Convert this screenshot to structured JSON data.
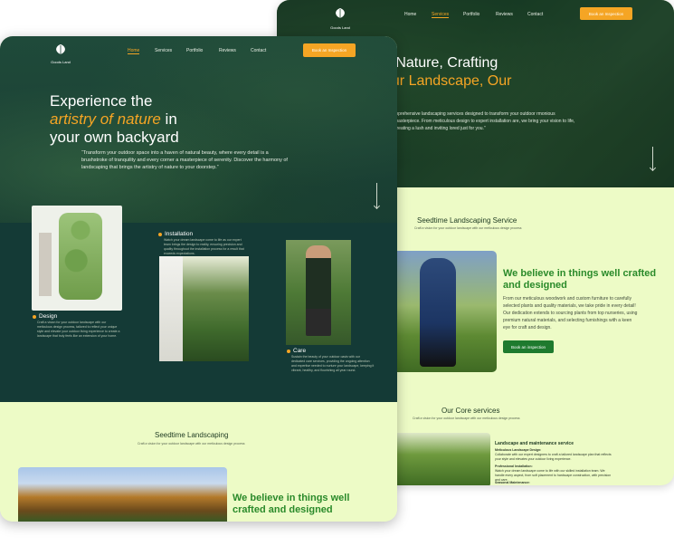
{
  "back": {
    "logo_text": "Goods Land",
    "nav": [
      "Home",
      "Services",
      "Portfolio",
      "Reviews",
      "Contact"
    ],
    "cta": "Book an Inspection",
    "hero_line1": "g Nature, Crafting",
    "hero_line2_white": "",
    "hero_line2_gold": "our Landscape, Our",
    "hero_line3": ".”",
    "hero_text": "mprehensive landscaping services designed to transform your outdoor rmonious masterpiece. From meticulous design to expert installation are, we bring your vision to life, creating a lush and inviting lored just for you.”",
    "section_title": "Seedtime Landscaping Service",
    "section_sub": "Craft a vision for your outdoor landscape with our meticulous design process",
    "heading": "We believe in things well crafted and designed",
    "para": "From our meticulous woodwork and custom furniture to carefully selected plants and quality materials, we take pride in every detail! Our dedication extends to sourcing plants from top nurseries, using premium natural materials, and selecting furnishings with a keen eye for craft and design.",
    "button": "Book an inspection",
    "core_title": "Our Core services",
    "core_sub": "Craft a vision for your outdoor landscape with our meticulous design process",
    "service_title": "Landscape and maintenance service",
    "service_items": [
      {
        "title": "Meticulous Landscape Design:",
        "text": "Collaborate with our expert designers to craft a tailored landscape plan that reflects your style and elevates your outdoor living experience."
      },
      {
        "title": "Professional Installation:",
        "text": "Watch your dream landscape come to life with our skilled installation team. We handle every aspect, from soft placement to hardscape construction, with precision and care."
      },
      {
        "title": "Seasonal Maintenance:",
        "text": ""
      }
    ]
  },
  "front": {
    "logo_text": "Goods Land",
    "nav": [
      "Home",
      "Services",
      "Portfolio",
      "Reviews",
      "Contact"
    ],
    "cta": "Book an Inspection",
    "h1_line1": "Experience the",
    "h1_gold": "artistry of nature",
    "h1_line2_rest": " in",
    "h1_line3": "your own backyard",
    "quote": "“Transform your outdoor space into a haven of natural beauty, where every detail is a brushstroke of tranquility and every corner a masterpiece of serenity. Discover the harmony of landscaping that brings the artistry of nature to your doorstep.”",
    "design_label": "Design",
    "design_text": "Craft a vision for your outdoor landscape with our meticulous design process, tailored to reflect your unique style and elevate your outdoor living experience to create a landscape that truly feels like an extension of your home.",
    "install_label": "Installation",
    "install_text": "Watch your dream landscape come to life as our expert team brings the design to reality, ensuring precision and quality throughout the installation process for a result that exceeds expectations.",
    "care_label": "Care",
    "care_text": "Sustain the beauty of your outdoor oasis with our dedicated care services, providing the ongoing attention and expertise needed to nurture your landscape, keeping it vibrant, healthy, and flourishing all year round.",
    "section_title": "Seedtime Landscaping",
    "section_sub": "Craft a vision for your outdoor landscape with our meticulous design process",
    "heading": "We believe in things well crafted and designed"
  },
  "colors": {
    "accent": "#f5a524",
    "dark_green": "#143a36",
    "light_bg": "#edfbc6",
    "green_text": "#2a8a2a"
  }
}
